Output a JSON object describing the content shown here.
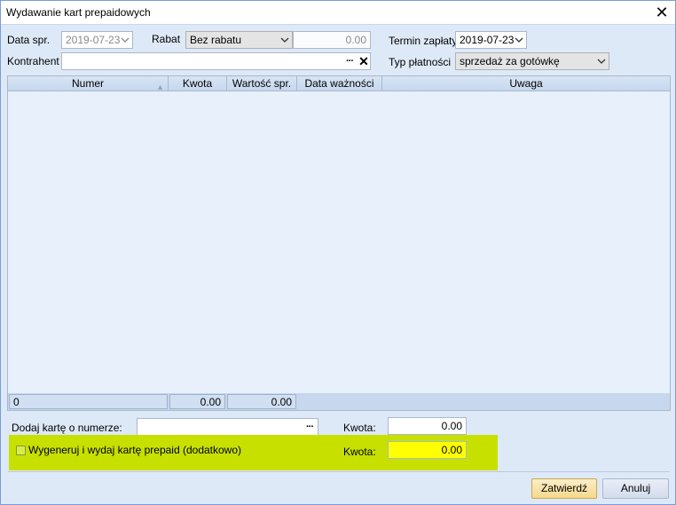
{
  "window": {
    "title": "Wydawanie kart prepaidowych",
    "close_icon": "close-icon"
  },
  "form": {
    "data_spr_label": "Data spr.",
    "data_spr_value": "2019-07-23",
    "rabat_label": "Rabat",
    "rabat_value": "Bez rabatu",
    "rabat_amount": "0.00",
    "termin_label": "Termin zapłaty",
    "termin_value": "2019-07-23",
    "kontrahent_label": "Kontrahent",
    "kontrahent_value": "",
    "typ_platnosci_label": "Typ płatności",
    "typ_platnosci_value": "sprzedaż za gotówkę"
  },
  "grid": {
    "columns": [
      "Numer",
      "Kwota",
      "Wartość spr.",
      "Data ważności",
      "Uwaga"
    ],
    "rows": [],
    "footer": {
      "count": "0",
      "kwota_sum": "0.00",
      "wartosc_sum": "0.00"
    }
  },
  "bottom": {
    "dodaj_label": "Dodaj kartę o numerze:",
    "dodaj_value": "",
    "kwota_label_1": "Kwota:",
    "kwota_value_1": "0.00",
    "wygeneruj_label": "Wygeneruj i wydaj kartę prepaid (dodatkowo)",
    "wygeneruj_checked": false,
    "kwota_label_2": "Kwota:",
    "kwota_value_2": "0.00",
    "highlight_color": "#c7e000"
  },
  "buttons": {
    "confirm": "Zatwierdź",
    "cancel": "Anuluj"
  }
}
